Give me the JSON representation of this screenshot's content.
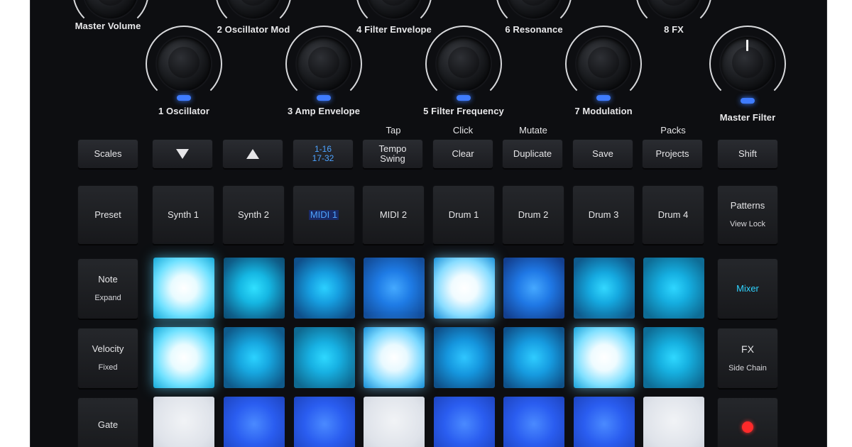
{
  "knob_labels_top": [
    "Master Volume",
    "2 Oscillator Mod",
    "4 Filter Envelope",
    "6 Resonance",
    "8 FX"
  ],
  "knob_labels_bottom": [
    "1 Oscillator",
    "3 Amp Envelope",
    "5 Filter Frequency",
    "7 Modulation",
    "Master Filter"
  ],
  "shift_labels": [
    "Tap",
    "Click",
    "Mutate",
    "Packs"
  ],
  "row1": {
    "scales": "Scales",
    "b3_line1": "1-16",
    "b3_line2": "17-32",
    "tempo_line1": "Tempo",
    "tempo_line2": "Swing",
    "clear": "Clear",
    "duplicate": "Duplicate",
    "save": "Save",
    "projects": "Projects",
    "shift": "Shift"
  },
  "row2": {
    "preset": "Preset",
    "tracks": [
      "Synth 1",
      "Synth 2",
      "MIDI 1",
      "MIDI 2",
      "Drum 1",
      "Drum 2",
      "Drum 3",
      "Drum 4"
    ],
    "patterns": "Patterns",
    "patterns_sub": "View Lock"
  },
  "left_column": {
    "note": "Note",
    "note_sub": "Expand",
    "velocity": "Velocity",
    "velocity_sub": "Fixed",
    "gate": "Gate"
  },
  "right_column": {
    "mixer": "Mixer",
    "fx": "FX",
    "fx_sub": "Side Chain"
  },
  "colors": {
    "body": "#0d0e11",
    "led_blue": "#3f7cff",
    "pad_cyan": "#1fb8e8",
    "pad_white": "#e9f7ff",
    "pad_blue": "#2a5df0",
    "record_red": "#ff2a2a"
  }
}
